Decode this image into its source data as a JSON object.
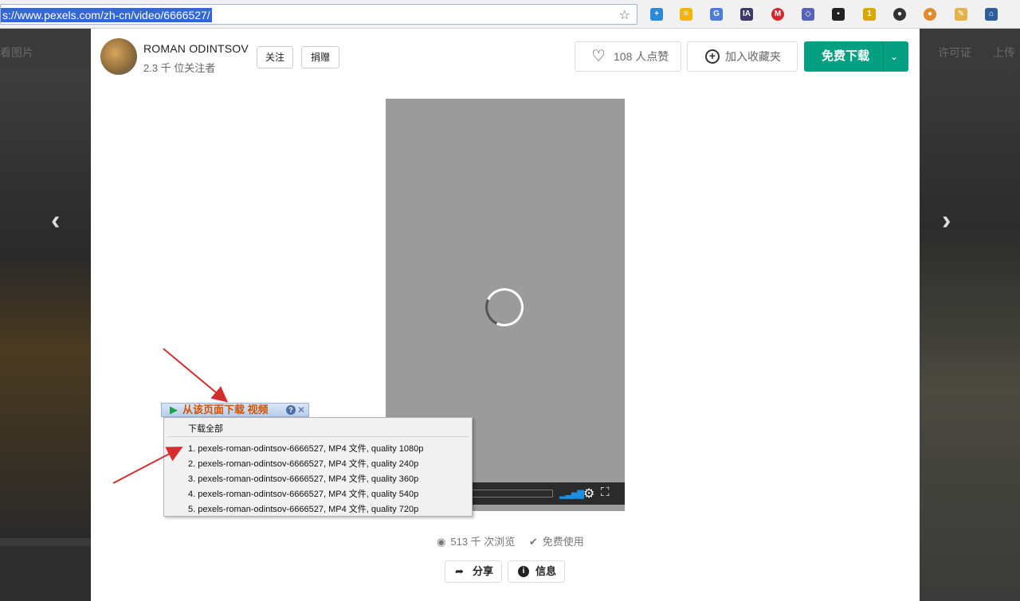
{
  "browser": {
    "url": "s://www.pexels.com/zh-cn/video/6666527/",
    "extension_icons": [
      "plus-icon",
      "note-icon",
      "translate-icon",
      "ia-icon",
      "m-icon",
      "cube-icon",
      "face-icon",
      "badge-icon",
      "dark-icon",
      "cookie-icon",
      "puzzle-icon",
      "home-icon"
    ]
  },
  "background": {
    "nav_left_text": "看图片",
    "nav_right_items": [
      "许可证",
      "上传"
    ]
  },
  "modal": {
    "author": {
      "name": "ROMAN ODINTSOV",
      "followers": "2.3 千 位关注者",
      "follow_label": "关注",
      "donate_label": "捐赠"
    },
    "like_label": "108 人点赞",
    "collect_label": "加入收藏夹",
    "download_label": "免费下载",
    "stats": {
      "views": "513 千 次浏览",
      "license": "免费使用"
    },
    "share_label": "分享",
    "info_label": "信息"
  },
  "download_popup": {
    "tag_text": "从该页面下载 视频",
    "download_all": "下载全部",
    "items": [
      "1.  pexels-roman-odintsov-6666527,  MP4 文件, quality 1080p",
      "2.  pexels-roman-odintsov-6666527,  MP4 文件, quality 240p",
      "3.  pexels-roman-odintsov-6666527,  MP4 文件, quality 360p",
      "4.  pexels-roman-odintsov-6666527,  MP4 文件, quality 540p",
      "5.  pexels-roman-odintsov-6666527,  MP4 文件, quality 720p"
    ]
  },
  "colors": {
    "download_green": "#05a081",
    "annotation_red": "#d32f2f"
  }
}
